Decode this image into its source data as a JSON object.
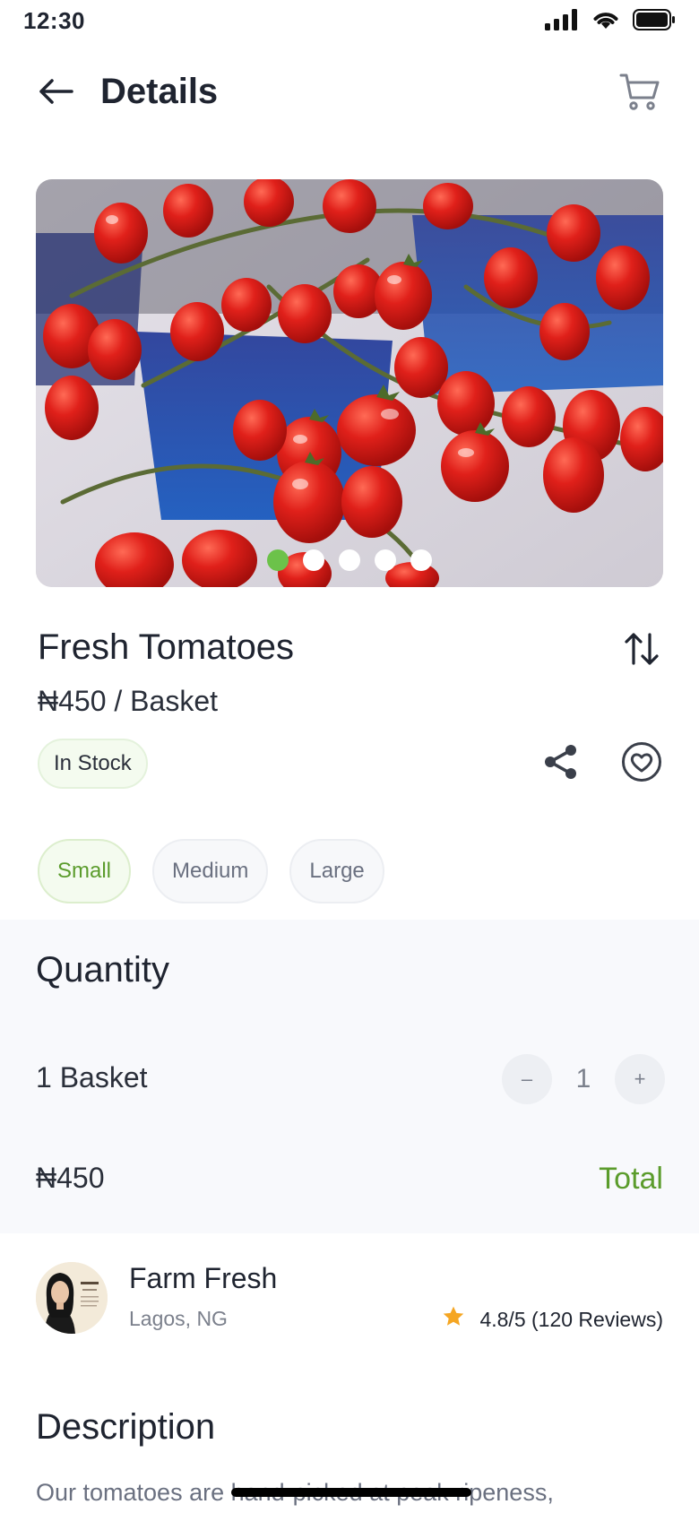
{
  "status_bar": {
    "time": "12:30"
  },
  "header": {
    "title": "Details"
  },
  "carousel": {
    "slide_count": 5,
    "active_index": 0,
    "accent_color": "#6cc24a"
  },
  "product": {
    "name": "Fresh Tomatoes",
    "price": "₦450 / Basket",
    "stock_label": "In Stock"
  },
  "sizes": [
    {
      "label": "Small",
      "selected": true
    },
    {
      "label": "Medium",
      "selected": false
    },
    {
      "label": "Large",
      "selected": false
    }
  ],
  "quantity": {
    "title": "Quantity",
    "unit_label": "1 Basket",
    "decrement_label": "–",
    "value": "1",
    "increment_label": "+",
    "total_price": "₦450",
    "total_label": "Total"
  },
  "seller": {
    "name": "Farm Fresh",
    "location": "Lagos, NG",
    "rating": "4.8/5 (120 Reviews)",
    "star_color": "#f5a623"
  },
  "description": {
    "title": "Description",
    "text": "Our tomatoes are hand-picked at peak ripeness,"
  },
  "icons": {
    "back": "arrow-left-icon",
    "cart": "cart-icon",
    "sort": "sort-arrows-icon",
    "share": "share-icon",
    "favorite": "heart-icon",
    "star": "star-icon"
  }
}
